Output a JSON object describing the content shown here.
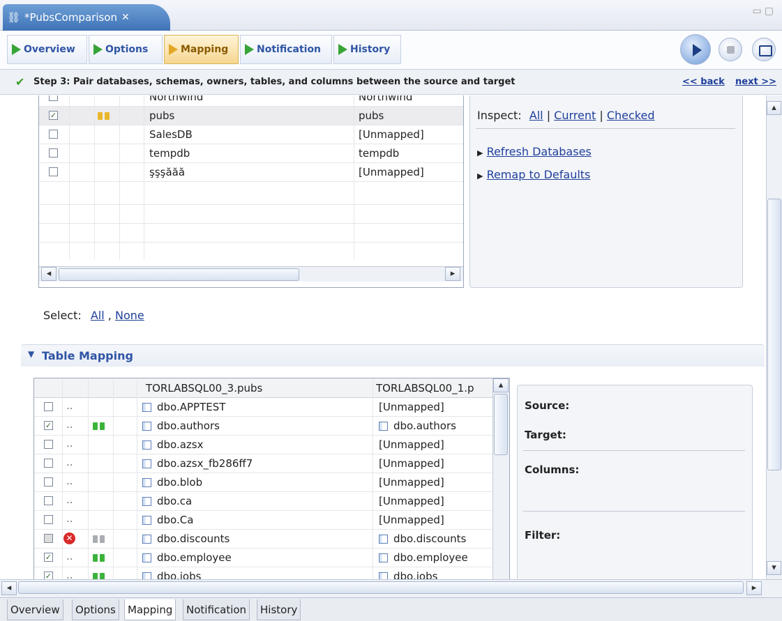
{
  "editor_tab": {
    "title": "*PubsComparison",
    "close": "✕"
  },
  "nav": {
    "overview": "Overview",
    "options": "Options",
    "mapping": "Mapping",
    "notification": "Notification",
    "history": "History"
  },
  "step": {
    "text": "Step 3: Pair databases, schemas, owners, tables, and columns between the source and target",
    "back": "<< back",
    "next": "next >>"
  },
  "databases": {
    "rows": [
      {
        "checked": false,
        "paired": false,
        "source": "Northwind",
        "target": "Northwind"
      },
      {
        "checked": true,
        "paired": true,
        "source": "pubs",
        "target": "pubs"
      },
      {
        "checked": false,
        "paired": false,
        "source": "SalesDB",
        "target": "[Unmapped]"
      },
      {
        "checked": false,
        "paired": false,
        "source": "tempdb",
        "target": "tempdb"
      },
      {
        "checked": false,
        "paired": false,
        "source": "şşşăăă",
        "target": "[Unmapped]"
      }
    ],
    "inspect_label": "Inspect:",
    "inspect_all": "All",
    "inspect_current": "Current",
    "inspect_checked": "Checked",
    "sep": "|",
    "refresh": "Refresh Databases",
    "remap": "Remap to Defaults",
    "select_label": "Select:",
    "select_all": "All",
    "select_comma": ",",
    "select_none": "None"
  },
  "table_mapping": {
    "title": "Table Mapping",
    "source_header": "TORLABSQL00_3.pubs",
    "target_header": "TORLABSQL00_1.p",
    "rows": [
      {
        "checked": false,
        "status": "..",
        "pair": "",
        "source": "dbo.APPTEST",
        "target": "[Unmapped]",
        "target_icon": false
      },
      {
        "checked": true,
        "status": "..",
        "pair": "green",
        "source": "dbo.authors",
        "target": "dbo.authors",
        "target_icon": true
      },
      {
        "checked": false,
        "status": "..",
        "pair": "",
        "source": "dbo.azsx",
        "target": "[Unmapped]",
        "target_icon": false
      },
      {
        "checked": false,
        "status": "..",
        "pair": "",
        "source": "dbo.azsx_fb286ff7",
        "target": "[Unmapped]",
        "target_icon": false
      },
      {
        "checked": false,
        "status": "..",
        "pair": "",
        "source": "dbo.blob",
        "target": "[Unmapped]",
        "target_icon": false
      },
      {
        "checked": false,
        "status": "..",
        "pair": "",
        "source": "dbo.ca",
        "target": "[Unmapped]",
        "target_icon": false
      },
      {
        "checked": false,
        "status": "..",
        "pair": "",
        "source": "dbo.Ca",
        "target": "[Unmapped]",
        "target_icon": false
      },
      {
        "checked": false,
        "status": "error",
        "pair": "gray",
        "source": "dbo.discounts",
        "target": "dbo.discounts",
        "target_icon": true
      },
      {
        "checked": true,
        "status": "..",
        "pair": "green",
        "source": "dbo.employee",
        "target": "dbo.employee",
        "target_icon": true
      },
      {
        "checked": true,
        "status": "..",
        "pair": "green",
        "source": "dbo.jobs",
        "target": "dbo.jobs",
        "target_icon": true
      }
    ],
    "details": {
      "source": "Source:",
      "target": "Target:",
      "columns": "Columns:",
      "filter": "Filter:"
    }
  },
  "bottom_tabs": [
    "Overview",
    "Options",
    "Mapping",
    "Notification",
    "History"
  ],
  "colors": {
    "accent": "#2f55a4",
    "active_tab": "#f6d690",
    "pair_green": "#3bb33b",
    "error": "#d92a2a"
  }
}
